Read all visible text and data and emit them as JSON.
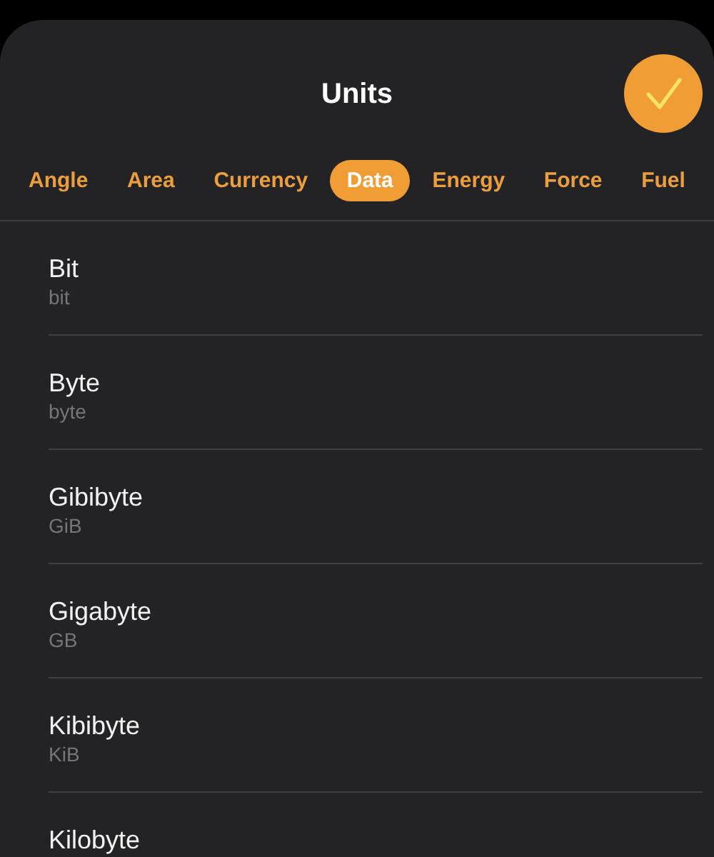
{
  "header": {
    "title": "Units",
    "done_button": {
      "kind": "check"
    }
  },
  "tabs": [
    {
      "label": "Angle",
      "selected": false
    },
    {
      "label": "Area",
      "selected": false
    },
    {
      "label": "Currency",
      "selected": false
    },
    {
      "label": "Data",
      "selected": true
    },
    {
      "label": "Energy",
      "selected": false
    },
    {
      "label": "Force",
      "selected": false
    },
    {
      "label": "Fuel",
      "selected": false
    }
  ],
  "units": [
    {
      "name": "Bit",
      "symbol": "bit"
    },
    {
      "name": "Byte",
      "symbol": "byte"
    },
    {
      "name": "Gibibyte",
      "symbol": "GiB"
    },
    {
      "name": "Gigabyte",
      "symbol": "GB"
    },
    {
      "name": "Kibibyte",
      "symbol": "KiB"
    },
    {
      "name": "Kilobyte"
    }
  ]
}
